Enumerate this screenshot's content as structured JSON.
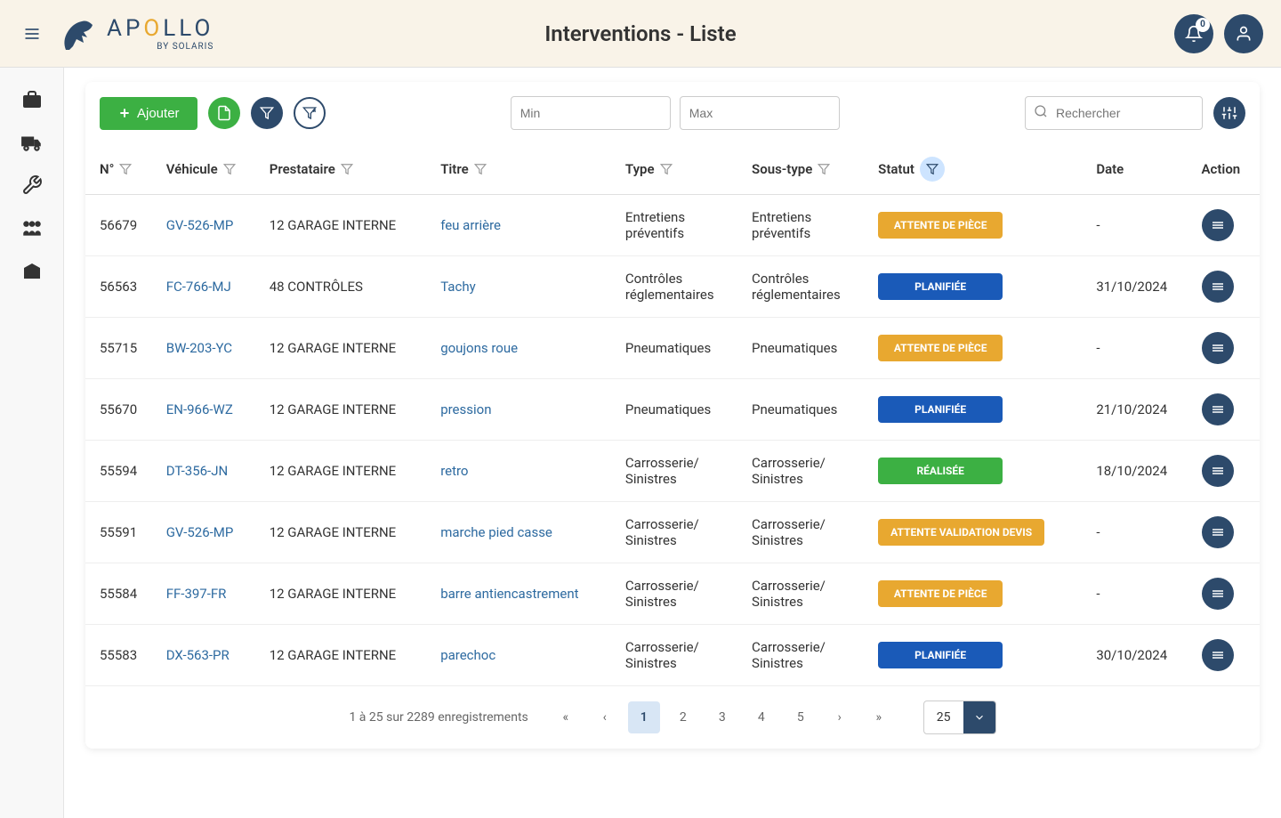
{
  "header": {
    "logo_text": "APOLLO",
    "logo_sub": "BY SOLARIS",
    "title": "Interventions - Liste",
    "notifications": "0"
  },
  "toolbar": {
    "add_label": "Ajouter",
    "min_placeholder": "Min",
    "max_placeholder": "Max",
    "search_placeholder": "Rechercher"
  },
  "columns": {
    "num": "N°",
    "vehicule": "Véhicule",
    "prestataire": "Prestataire",
    "titre": "Titre",
    "type": "Type",
    "soustype": "Sous-type",
    "statut": "Statut",
    "date": "Date",
    "action": "Action"
  },
  "statuses": {
    "attente_piece": "ATTENTE DE PIÈCE",
    "planifiee": "PLANIFIÉE",
    "realisee": "RÉALISÉE",
    "attente_devis": "ATTENTE VALIDATION DEVIS"
  },
  "rows": [
    {
      "num": "56679",
      "vehicule": "GV-526-MP",
      "prestataire": "12 GARAGE INTERNE",
      "titre": "feu arrière",
      "type": "Entretiens préventifs",
      "soustype": "Entretiens préventifs",
      "statut": "attente_piece",
      "statut_class": "yellow",
      "date": "-"
    },
    {
      "num": "56563",
      "vehicule": "FC-766-MJ",
      "prestataire": "48 CONTRÔLES",
      "titre": "Tachy",
      "type": "Contrôles réglementaires",
      "soustype": "Contrôles réglementaires",
      "statut": "planifiee",
      "statut_class": "blue",
      "date": "31/10/2024"
    },
    {
      "num": "55715",
      "vehicule": "BW-203-YC",
      "prestataire": "12 GARAGE INTERNE",
      "titre": "goujons roue",
      "type": "Pneumatiques",
      "soustype": "Pneumatiques",
      "statut": "attente_piece",
      "statut_class": "yellow",
      "date": "-"
    },
    {
      "num": "55670",
      "vehicule": "EN-966-WZ",
      "prestataire": "12 GARAGE INTERNE",
      "titre": "pression",
      "type": "Pneumatiques",
      "soustype": "Pneumatiques",
      "statut": "planifiee",
      "statut_class": "blue",
      "date": "21/10/2024"
    },
    {
      "num": "55594",
      "vehicule": "DT-356-JN",
      "prestataire": "12 GARAGE INTERNE",
      "titre": "retro",
      "type": "Carrosserie/Sinistres",
      "soustype": "Carrosserie/Sinistres",
      "statut": "realisee",
      "statut_class": "green",
      "date": "18/10/2024"
    },
    {
      "num": "55591",
      "vehicule": "GV-526-MP",
      "prestataire": "12 GARAGE INTERNE",
      "titre": "marche pied casse",
      "type": "Carrosserie/Sinistres",
      "soustype": "Carrosserie/Sinistres",
      "statut": "attente_devis",
      "statut_class": "yellow",
      "date": "-"
    },
    {
      "num": "55584",
      "vehicule": "FF-397-FR",
      "prestataire": "12 GARAGE INTERNE",
      "titre": "barre antiencastrement",
      "type": "Carrosserie/Sinistres",
      "soustype": "Carrosserie/Sinistres",
      "statut": "attente_piece",
      "statut_class": "yellow",
      "date": "-"
    },
    {
      "num": "55583",
      "vehicule": "DX-563-PR",
      "prestataire": "12 GARAGE INTERNE",
      "titre": "parechoc",
      "type": "Carrosserie/Sinistres",
      "soustype": "Carrosserie/Sinistres",
      "statut": "planifiee",
      "statut_class": "blue",
      "date": "30/10/2024"
    }
  ],
  "pagination": {
    "info": "1 à 25 sur 2289 enregistrements",
    "pages": [
      "1",
      "2",
      "3",
      "4",
      "5"
    ],
    "current": "1",
    "page_size": "25"
  }
}
